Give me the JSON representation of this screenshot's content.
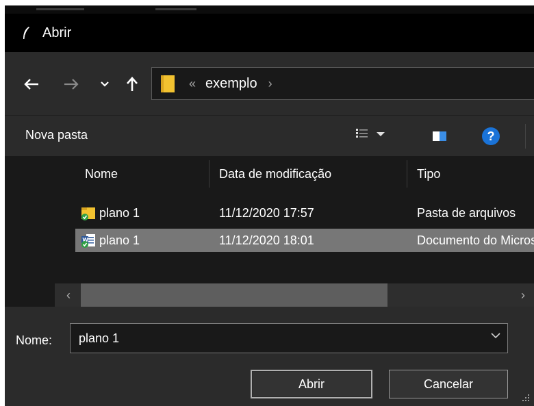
{
  "window": {
    "title": "Abrir"
  },
  "nav": {
    "back_icon": "arrow-left-icon",
    "forward_icon": "arrow-right-icon",
    "recent_icon": "chevron-down-icon",
    "up_icon": "arrow-up-icon"
  },
  "address": {
    "separator": "«",
    "crumb": "exemplo",
    "chevron": "›"
  },
  "toolbar": {
    "new_folder": "Nova pasta"
  },
  "columns": {
    "name": "Nome",
    "modified": "Data de modificação",
    "type": "Tipo"
  },
  "files": [
    {
      "name": "plano 1",
      "modified": "11/12/2020 17:57",
      "type": "Pasta de arquivos",
      "icon": "folder-icon",
      "selected": false
    },
    {
      "name": "plano 1",
      "modified": "11/12/2020 18:01",
      "type": "Documento do Microsoft Word",
      "icon": "word-document-icon",
      "selected": true
    }
  ],
  "scroll": {
    "left_arrow": "‹",
    "right_arrow": "›"
  },
  "footer": {
    "name_label": "Nome:",
    "name_value": "plano 1",
    "open_button": "Abrir",
    "cancel_button": "Cancelar"
  },
  "colors": {
    "accent_help": "#1a73d8",
    "folder": "#f2c230",
    "selection": "#777777"
  }
}
